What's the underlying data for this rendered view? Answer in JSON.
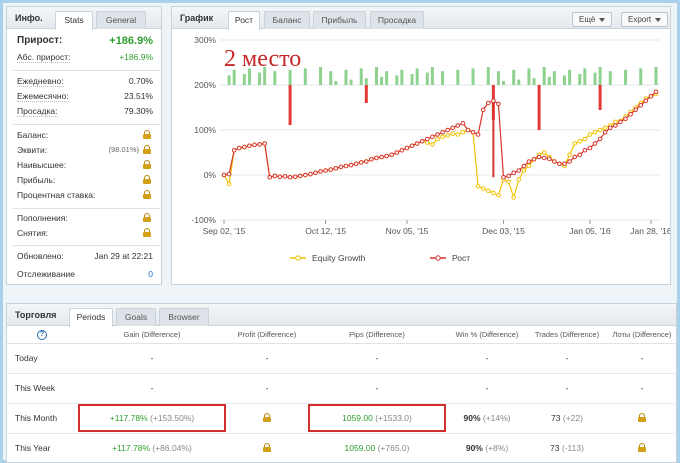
{
  "info": {
    "title": "Инфо.",
    "tabs": [
      "Stats",
      "General"
    ],
    "rows_top": [
      {
        "label": "Прирост:",
        "value": "+186.9%"
      },
      {
        "label": "Абс. прирост:",
        "value": "+186.9%"
      }
    ],
    "rows_rates": [
      {
        "label": "Ежедневно:",
        "value": "0.70%"
      },
      {
        "label": "Ежемесячно:",
        "value": "23.51%"
      },
      {
        "label": "Просадка:",
        "value": "79.30%"
      }
    ],
    "rows_locked": [
      {
        "label": "Баланс:",
        "value": ""
      },
      {
        "label": "Эквити:",
        "value": "(98.01%)"
      },
      {
        "label": "Наивысшее:",
        "value": ""
      },
      {
        "label": "Прибыль:",
        "value": ""
      },
      {
        "label": "Процентная ставка:",
        "value": ""
      }
    ],
    "rows_flow": [
      {
        "label": "Пополнения:"
      },
      {
        "label": "Снятия:"
      }
    ],
    "updated_label": "Обновлено:",
    "updated_value": "Jan 29 at 22:21",
    "tracking_label": "Отслеживание",
    "tracking_value": "0"
  },
  "chart_panel": {
    "title": "График",
    "tabs": [
      "Рост",
      "Баланс",
      "Прибыль",
      "Просадка"
    ],
    "export_label": "Export",
    "more_label": "Ещё",
    "overlay_text": "2 место"
  },
  "chart_data": {
    "type": "line",
    "ylim": [
      -100,
      300
    ],
    "y_ticks": [
      "300%",
      "200%",
      "100%",
      "0%",
      "-100%"
    ],
    "x_ticks": [
      "Sep 02, '15",
      "Oct 12, '15",
      "Nov 05, '15",
      "Dec 03, '15",
      "Jan 05, '16",
      "Jan 28, '16"
    ],
    "series": [
      {
        "name": "Equity Growth",
        "color": "#f2c200",
        "values": [
          0,
          -20,
          55,
          60,
          62,
          65,
          67,
          68,
          70,
          -5,
          -2,
          -4,
          -3,
          -5,
          -4,
          -2,
          0,
          2,
          5,
          8,
          10,
          12,
          15,
          18,
          20,
          22,
          25,
          28,
          30,
          35,
          38,
          40,
          42,
          45,
          50,
          55,
          60,
          65,
          70,
          75,
          72,
          68,
          80,
          85,
          88,
          92,
          90,
          95,
          100,
          95,
          -25,
          -30,
          -35,
          -40,
          -45,
          -10,
          -15,
          -50,
          -10,
          10,
          20,
          35,
          45,
          50,
          40,
          30,
          25,
          20,
          45,
          70,
          75,
          80,
          90,
          95,
          100,
          105,
          110,
          118,
          120,
          130,
          140,
          150,
          160,
          170,
          175,
          180
        ]
      },
      {
        "name": "Рост",
        "color": "#d9342b",
        "values": [
          0,
          2,
          55,
          60,
          62,
          65,
          67,
          68,
          70,
          -5,
          -2,
          -4,
          -3,
          -5,
          -4,
          -2,
          0,
          2,
          5,
          8,
          10,
          12,
          15,
          18,
          20,
          22,
          25,
          28,
          30,
          35,
          38,
          40,
          42,
          45,
          50,
          55,
          60,
          65,
          70,
          75,
          80,
          85,
          90,
          95,
          100,
          105,
          110,
          115,
          100,
          95,
          90,
          145,
          160,
          165,
          158,
          -5,
          -2,
          5,
          10,
          20,
          30,
          35,
          40,
          38,
          36,
          30,
          25,
          25,
          30,
          40,
          45,
          55,
          60,
          70,
          80,
          95,
          105,
          110,
          118,
          125,
          135,
          145,
          155,
          165,
          175,
          185
        ]
      }
    ],
    "bars": [
      0,
      0,
      0,
      0,
      30,
      0,
      0,
      0,
      0,
      0,
      -10,
      0,
      0,
      0,
      0,
      0,
      0,
      0,
      0,
      0,
      0,
      0,
      0,
      0,
      0,
      0,
      0,
      0,
      0,
      0,
      0,
      0,
      0,
      0,
      0,
      0,
      0,
      0,
      0,
      0,
      0,
      0,
      0,
      0,
      0,
      0,
      0,
      0,
      0,
      0,
      0,
      0,
      0,
      0,
      0,
      0,
      0,
      0,
      0,
      0,
      0,
      0,
      0,
      0,
      0,
      0,
      0,
      0,
      0,
      0,
      0,
      0,
      0,
      0,
      0,
      0,
      0,
      0,
      0,
      0,
      0,
      0,
      0,
      0,
      0,
      0
    ],
    "legend": [
      "Equity Growth",
      "Рост"
    ]
  },
  "trade": {
    "title": "Торговля",
    "tabs": [
      "Periods",
      "Goals",
      "Browser"
    ],
    "columns": [
      "Gain (Difference)",
      "Profit (Difference)",
      "Pips (Difference)",
      "Win % (Difference)",
      "Trades (Difference)",
      "Лоты (Difference)"
    ],
    "rows": [
      {
        "label": "Today",
        "gain": "-",
        "gain_diff": "",
        "profit": "-",
        "pips": "-",
        "pips_diff": "",
        "win": "-",
        "win_diff": "",
        "trades": "-",
        "trades_diff": "",
        "lots": "-"
      },
      {
        "label": "This Week",
        "gain": "-",
        "gain_diff": "",
        "profit": "-",
        "pips": "-",
        "pips_diff": "",
        "win": "-",
        "win_diff": "",
        "trades": "-",
        "trades_diff": "",
        "lots": "-"
      },
      {
        "label": "This Month",
        "gain": "+117.78%",
        "gain_diff": "(+153.50%)",
        "profit": "lock",
        "pips": "1059.00",
        "pips_diff": "(+1533.0)",
        "win": "90%",
        "win_diff": "(+14%)",
        "trades": "73",
        "trades_diff": "(+22)",
        "lots": "lock"
      },
      {
        "label": "This Year",
        "gain": "+117.78%",
        "gain_diff": "(+86.04%)",
        "profit": "lock",
        "pips": "1059.00",
        "pips_diff": "(+765.0)",
        "win": "90%",
        "win_diff": "(+8%)",
        "trades": "73",
        "trades_diff": "(-113)",
        "lots": "lock"
      }
    ]
  }
}
